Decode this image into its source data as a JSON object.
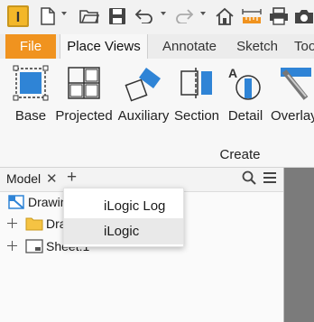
{
  "app": {
    "logo_letter": "I"
  },
  "quick_access": {
    "icons": [
      "app-logo-icon",
      "new-document-icon",
      "open-folder-icon",
      "save-icon",
      "undo-icon",
      "redo-icon",
      "home-icon",
      "measure-icon",
      "print-icon",
      "camera-icon"
    ]
  },
  "tabs": [
    {
      "label": "File"
    },
    {
      "label": "Place Views"
    },
    {
      "label": "Annotate"
    },
    {
      "label": "Sketch"
    },
    {
      "label": "Too"
    }
  ],
  "ribbon": {
    "tools": [
      {
        "label": "Base"
      },
      {
        "label": "Projected"
      },
      {
        "label": "Auxiliary"
      },
      {
        "label": "Section"
      },
      {
        "label": "Detail"
      },
      {
        "label": "Overlay"
      }
    ],
    "panel_label": "Create"
  },
  "browser": {
    "title": "Model",
    "tree": [
      {
        "label": "Drawin"
      },
      {
        "label": "Dra"
      },
      {
        "label": "Sheet:1"
      }
    ]
  },
  "menu": {
    "items": [
      {
        "label": "iLogic Log"
      },
      {
        "label": "iLogic"
      }
    ]
  },
  "colors": {
    "accent": "#f0931f",
    "icon_blue": "#2f84d6",
    "canvas": "#7b7b7b"
  }
}
